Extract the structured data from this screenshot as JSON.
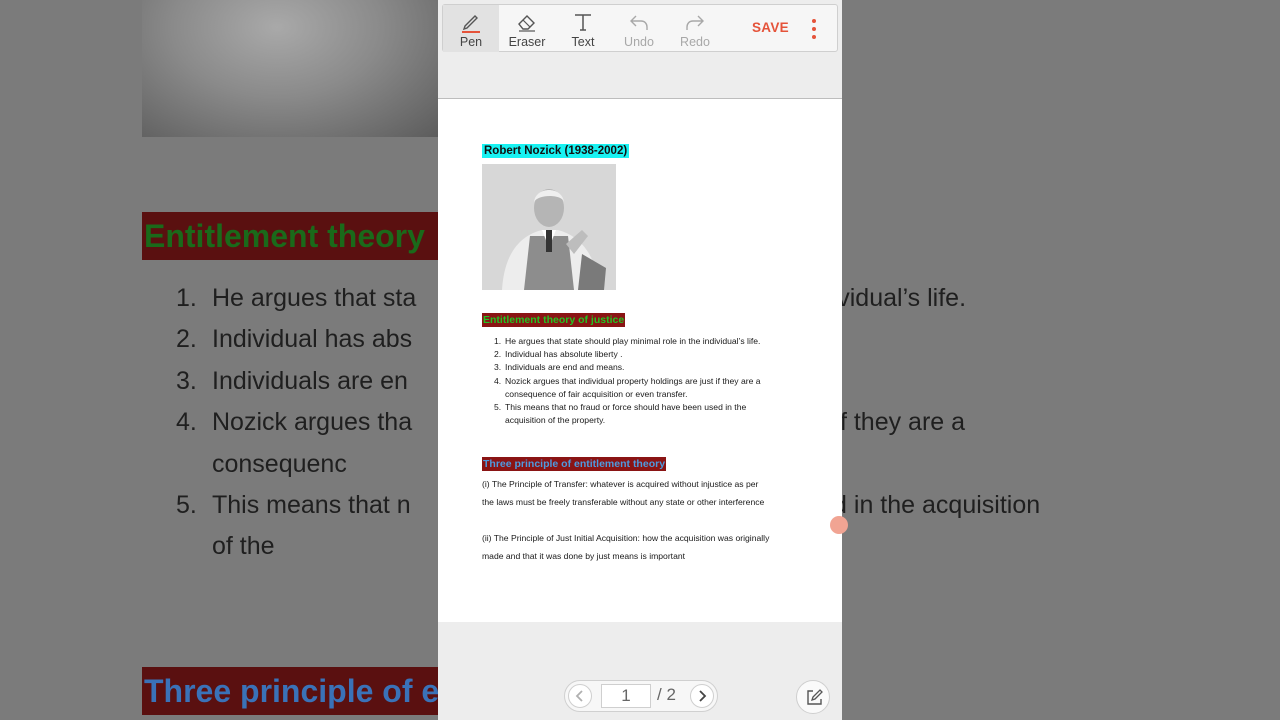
{
  "background": {
    "heading1": "Entitlement theory",
    "heading2": "Three principle of er",
    "list": [
      {
        "n": "1.",
        "text": "He argues that sta                                                  he individual’s life."
      },
      {
        "n": "2.",
        "text": "Individual has abs"
      },
      {
        "n": "3.",
        "text": "Individuals are en"
      },
      {
        "n": "4.",
        "text": "Nozick argues tha                                                  re just if they are a consequenc                                                  sfer."
      },
      {
        "n": "5.",
        "text": "This means that n                                                  en used in the acquisition of the"
      }
    ]
  },
  "toolbar": {
    "tools": [
      {
        "label": "Pen",
        "icon": "pen-icon"
      },
      {
        "label": "Eraser",
        "icon": "eraser-icon"
      },
      {
        "label": "Text",
        "icon": "text-icon"
      },
      {
        "label": "Undo",
        "icon": "undo-icon"
      },
      {
        "label": "Redo",
        "icon": "redo-icon"
      }
    ],
    "save_label": "SAVE",
    "more_icon": "more-vert-icon",
    "accent_color": "#e5533a"
  },
  "document": {
    "title": "Robert Nozick (1938-2002)",
    "section1_heading": "Entitlement theory of justice",
    "items": [
      {
        "n": "1.",
        "text": "He argues that state should play minimal role in the individual’s life."
      },
      {
        "n": "2.",
        "text": "Individual has absolute liberty ."
      },
      {
        "n": "3.",
        "text": "Individuals are end and means."
      },
      {
        "n": "4.",
        "text": "Nozick argues that individual property holdings are just if they are a consequence of fair acquisition or even transfer."
      },
      {
        "n": "5.",
        "text": "This means that no fraud or force should have been used in the acquisition of the property."
      }
    ],
    "section2_heading": "Three principle of entitlement theory",
    "principle1": "(i) The Principle of Transfer: whatever is acquired without injustice as per the laws must be freely transferable without any state or other interference",
    "principle2": "(ii) The Principle of Just Initial Acquisition: how the acquisition was originally made and that it was done by just means is important"
  },
  "pager": {
    "current": "1",
    "total": "/ 2",
    "prev_icon": "chevron-left-icon",
    "next_icon": "chevron-right-icon"
  },
  "export_icon": "export-edit-icon"
}
